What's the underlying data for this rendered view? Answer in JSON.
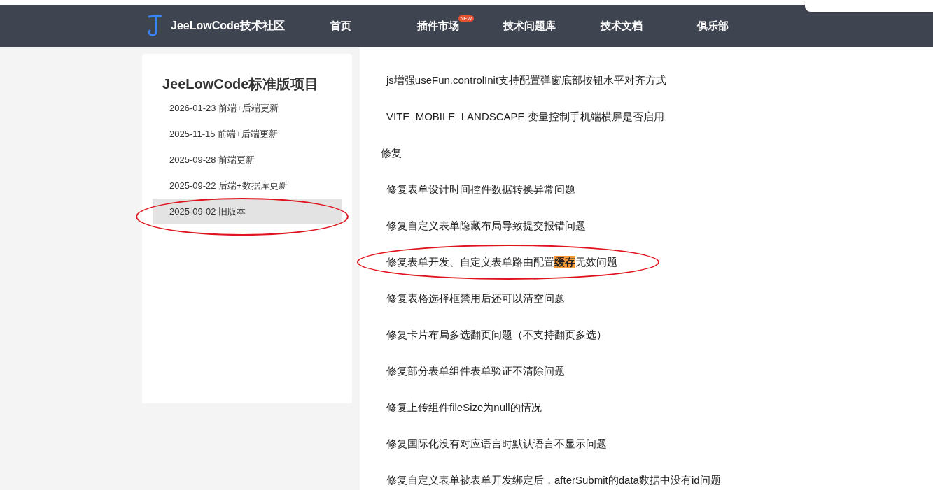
{
  "header": {
    "logo_text": "JeeLowCode技术社区",
    "nav": [
      {
        "label": "首页"
      },
      {
        "label": "插件市场",
        "badge": "NEW"
      },
      {
        "label": "技术问题库"
      },
      {
        "label": "技术文档"
      },
      {
        "label": "俱乐部"
      }
    ]
  },
  "sidebar": {
    "title": "JeeLowCode标准版项目",
    "items": [
      {
        "label": "2026-01-23 前端+后端更新",
        "selected": false,
        "circled": false
      },
      {
        "label": "2025-11-15 前端+后端更新",
        "selected": false,
        "circled": false
      },
      {
        "label": "2025-09-28 前端更新",
        "selected": false,
        "circled": false
      },
      {
        "label": "2025-09-22 后端+数据库更新",
        "selected": false,
        "circled": false
      },
      {
        "label": "2025-09-02 旧版本",
        "selected": true,
        "circled": true
      }
    ]
  },
  "content": [
    {
      "kind": "item",
      "circled": false,
      "parts": [
        {
          "text": "js增强useFun.controlInit支持配置弹窗底部按钮水平对齐方式",
          "highlight": false
        }
      ]
    },
    {
      "kind": "item",
      "circled": false,
      "parts": [
        {
          "text": "VITE_MOBILE_LANDSCAPE 变量控制手机端横屏是否启用",
          "highlight": false
        }
      ]
    },
    {
      "kind": "heading",
      "circled": false,
      "parts": [
        {
          "text": "修复",
          "highlight": false
        }
      ]
    },
    {
      "kind": "item",
      "circled": false,
      "parts": [
        {
          "text": "修复表单设计时间控件数据转换异常问题",
          "highlight": false
        }
      ]
    },
    {
      "kind": "item",
      "circled": false,
      "parts": [
        {
          "text": "修复自定义表单隐藏布局导致提交报错问题",
          "highlight": false
        }
      ]
    },
    {
      "kind": "item",
      "circled": true,
      "parts": [
        {
          "text": "修复表单开发、自定义表单路由配置",
          "highlight": false
        },
        {
          "text": "缓存",
          "highlight": true
        },
        {
          "text": "无效问题",
          "highlight": false
        }
      ]
    },
    {
      "kind": "item",
      "circled": false,
      "parts": [
        {
          "text": "修复表格选择框禁用后还可以清空问题",
          "highlight": false
        }
      ]
    },
    {
      "kind": "item",
      "circled": false,
      "parts": [
        {
          "text": "修复卡片布局多选翻页问题（不支持翻页多选）",
          "highlight": false
        }
      ]
    },
    {
      "kind": "item",
      "circled": false,
      "parts": [
        {
          "text": "修复部分表单组件表单验证不清除问题",
          "highlight": false
        }
      ]
    },
    {
      "kind": "item",
      "circled": false,
      "parts": [
        {
          "text": "修复上传组件fileSize为null的情况",
          "highlight": false
        }
      ]
    },
    {
      "kind": "item",
      "circled": false,
      "parts": [
        {
          "text": "修复国际化没有对应语言时默认语言不显示问题",
          "highlight": false
        }
      ]
    },
    {
      "kind": "item",
      "circled": false,
      "parts": [
        {
          "text": "修复自定义表单被表单开发绑定后，afterSubmit的data数据中没有id问题",
          "highlight": false
        }
      ]
    }
  ]
}
